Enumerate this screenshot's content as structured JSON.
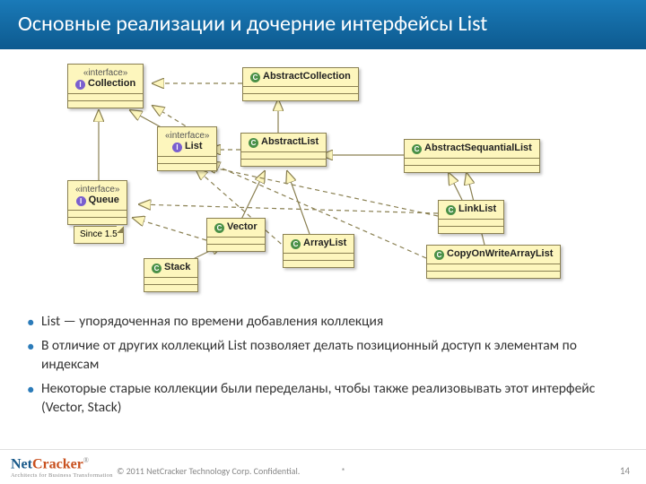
{
  "header": {
    "title": "Основные реализации и дочерние интерфейсы List"
  },
  "diagram": {
    "stereotype": "«interface»",
    "classes": {
      "collection": "Collection",
      "list": "List",
      "queue": "Queue",
      "abstractCollection": "AbstractCollection",
      "abstractList": "AbstractList",
      "abstractSequentialList": "AbstractSequantialList",
      "vector": "Vector",
      "arrayList": "ArrayList",
      "linkList": "LinkList",
      "copyOnWriteArrayList": "CopyOnWriteArrayList",
      "stack": "Stack"
    },
    "note": "Since 1.5"
  },
  "bullets": [
    "List — упорядоченная по времени добавления коллекция",
    "В отличие от других коллекций List позволяет делать позиционный доступ к элементам по индексам",
    "Некоторые старые коллекции были переделаны, чтобы также реализовывать этот интерфейс  (Vector, Stack)"
  ],
  "footer": {
    "logoMain": "Net",
    "logoCracker": "Cracker",
    "logoTag": "Architects for Business Transformation",
    "copyright": "© 2011 NetCracker Technology Corp. Confidential.",
    "marker": "*",
    "page": "14"
  }
}
